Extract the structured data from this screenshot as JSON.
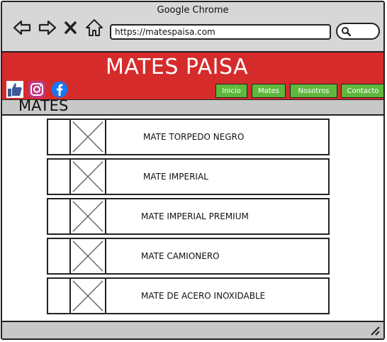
{
  "window": {
    "title": "Google Chrome"
  },
  "address_bar": {
    "url": "https://matespaisa.com"
  },
  "site": {
    "title": "MATES PAISA",
    "brand_color": "#d62b2b",
    "accent_color": "#5fb83e"
  },
  "social": [
    "facebook-like-icon",
    "instagram-icon",
    "facebook-icon"
  ],
  "nav": {
    "tabs": [
      {
        "label": "Inicio"
      },
      {
        "label": "Mates"
      },
      {
        "label": "Nosotros"
      },
      {
        "label": "Contacto"
      }
    ]
  },
  "section": {
    "title": "MATES"
  },
  "products": [
    {
      "name": "MATE TORPEDO NEGRO"
    },
    {
      "name": "MATE IMPERIAL"
    },
    {
      "name": "MATE IMPERIAL PREMIUM"
    },
    {
      "name": "MATE CAMIONERO"
    },
    {
      "name": "MATE DE ACERO INOXIDABLE"
    }
  ]
}
